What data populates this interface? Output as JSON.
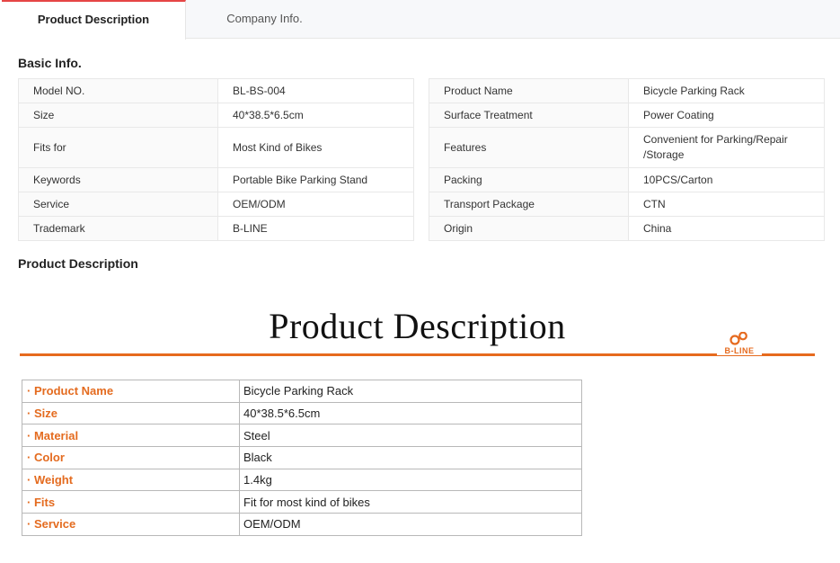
{
  "tabs": {
    "product_description": "Product Description",
    "company_info": "Company Info."
  },
  "basic_info": {
    "title": "Basic Info.",
    "left": [
      {
        "key": "Model NO.",
        "value": "BL-BS-004"
      },
      {
        "key": "Size",
        "value": "40*38.5*6.5cm"
      },
      {
        "key": "Fits for",
        "value": "Most Kind of Bikes"
      },
      {
        "key": "Keywords",
        "value": "Portable Bike Parking Stand"
      },
      {
        "key": "Service",
        "value": "OEM/ODM"
      },
      {
        "key": "Trademark",
        "value": "B-LINE"
      }
    ],
    "right": [
      {
        "key": "Product Name",
        "value": "Bicycle Parking Rack"
      },
      {
        "key": "Surface Treatment",
        "value": "Power Coating"
      },
      {
        "key": "Features",
        "value": "Convenient for Parking/Repair /Storage"
      },
      {
        "key": "Packing",
        "value": "10PCS/Carton"
      },
      {
        "key": "Transport Package",
        "value": "CTN"
      },
      {
        "key": "Origin",
        "value": "China"
      }
    ]
  },
  "product_description": {
    "title": "Product Description",
    "banner_title": "Product Description",
    "logo_text": "B-LINE",
    "specs": [
      {
        "key": "· Product Name",
        "value": "Bicycle Parking Rack"
      },
      {
        "key": "· Size",
        "value": "40*38.5*6.5cm"
      },
      {
        "key": "· Material",
        "value": "Steel"
      },
      {
        "key": "· Color",
        "value": "Black"
      },
      {
        "key": "· Weight",
        "value": "1.4kg"
      },
      {
        "key": "· Fits",
        "value": "Fit for most kind of bikes"
      },
      {
        "key": "· Service",
        "value": "OEM/ODM"
      }
    ]
  },
  "colors": {
    "accent": "#e66a1e",
    "tab_indicator": "#e64545"
  }
}
